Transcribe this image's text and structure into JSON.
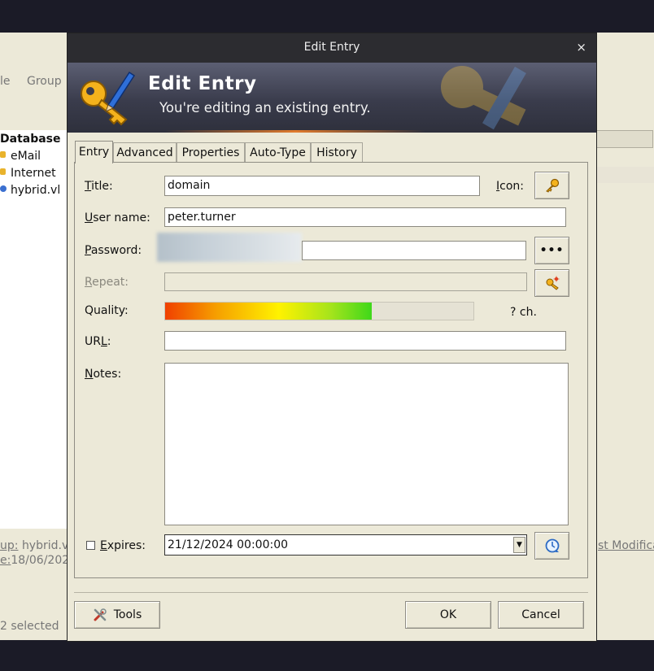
{
  "background_app": {
    "menu": [
      "le",
      "Group"
    ],
    "tree": {
      "root": "Database",
      "groups": [
        "eMail",
        "Internet",
        "hybrid.vl"
      ]
    },
    "details": {
      "group_label": "up:",
      "group_value": "hybrid.vl,",
      "created_label": "e:",
      "created_value": "18/06/202",
      "right_link": "st Modifica"
    },
    "status": "2 selected"
  },
  "dialog": {
    "window_title": "Edit Entry",
    "close_glyph": "×",
    "banner": {
      "title": "Edit Entry",
      "subtitle": "You're editing an existing entry."
    },
    "tabs": [
      "Entry",
      "Advanced",
      "Properties",
      "Auto-Type",
      "History"
    ],
    "active_tab": "Entry",
    "fields": {
      "title": {
        "label": "Title:",
        "accel": "T",
        "value": "domain"
      },
      "icon": {
        "label": "Icon:",
        "accel": "I"
      },
      "username": {
        "label": "User name:",
        "accel": "U",
        "value": "peter.turner"
      },
      "password": {
        "label": "Password:",
        "accel": "P",
        "value": ""
      },
      "repeat": {
        "label": "Repeat:",
        "accel": "R",
        "value": ""
      },
      "quality": {
        "label": "Quality:",
        "fill_fraction": 0.67,
        "chars_text": "? ch."
      },
      "url": {
        "label": "URL:",
        "accel": "R",
        "value": ""
      },
      "notes": {
        "label": "Notes:",
        "accel": "N",
        "value": ""
      },
      "expires": {
        "label": "Expires:",
        "accel": "E",
        "checked": false,
        "value": "21/12/2024 00:00:00"
      }
    },
    "buttons": {
      "show_password": "•••",
      "tools": "Tools",
      "ok": "OK",
      "cancel": "Cancel"
    },
    "colors": {
      "titlebar": "#2c2c30",
      "dialog_bg": "#ece9d8",
      "banner_top": "#5c5f73"
    }
  }
}
